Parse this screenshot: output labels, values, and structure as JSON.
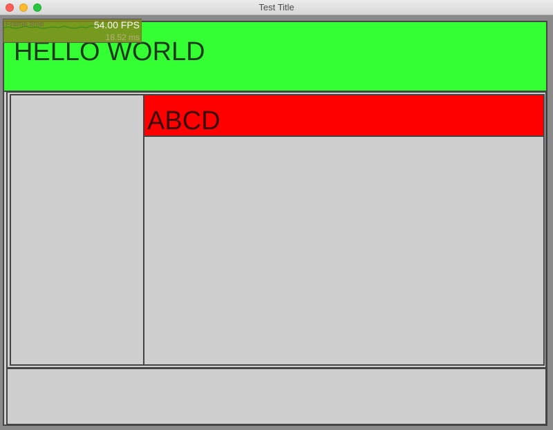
{
  "window": {
    "title": "Test Title"
  },
  "header": {
    "text": "HELLO WORLD"
  },
  "panel": {
    "banner_text": "ABCD"
  },
  "fps_overlay": {
    "label": "Frame time",
    "fps": "54.00 FPS",
    "ms": "18.52 ms"
  },
  "colors": {
    "header_bg": "#33ff33",
    "banner_bg": "#ff0000",
    "panel_bg": "#cfcfcf",
    "border": "#444444"
  }
}
